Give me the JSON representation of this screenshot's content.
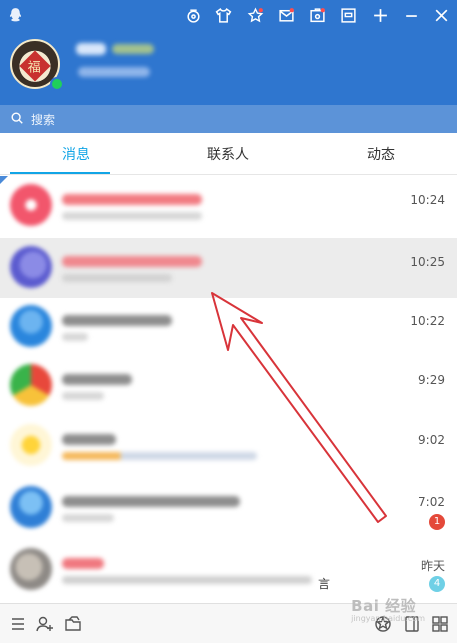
{
  "header": {
    "toolbar_icons": [
      "skin-icon",
      "shirt-icon",
      "star-icon",
      "mail-icon",
      "app-box-icon",
      "screen-icon",
      "add-icon",
      "minimize-icon",
      "close-icon"
    ],
    "avatar_char": "福",
    "online_color": "#1fd05b",
    "accent": "#2f76cf"
  },
  "search": {
    "placeholder": "搜索"
  },
  "tabs": [
    {
      "label": "消息",
      "active": true
    },
    {
      "label": "联系人",
      "active": false
    },
    {
      "label": "动态",
      "active": false
    }
  ],
  "conversations": [
    {
      "time": "10:24",
      "badge": ""
    },
    {
      "time": "10:25",
      "badge": "",
      "selected": true
    },
    {
      "time": "10:22",
      "badge": ""
    },
    {
      "time": "9:29",
      "badge": ""
    },
    {
      "time": "9:02",
      "badge": ""
    },
    {
      "time": "7:02",
      "badge": "1",
      "badge_color": "#e4493a"
    },
    {
      "time": "昨天",
      "badge": "4",
      "badge_color": "#6fd0e6",
      "tail": "言"
    }
  ],
  "bottombar": {
    "icons": [
      "menu-icon",
      "add-contact-icon",
      "folder-icon",
      "qzone-icon",
      "tablet-icon",
      "apps-icon"
    ]
  },
  "watermark": {
    "text": "Bai 经验",
    "sub": "jingyan.baidu.com"
  },
  "annotation": {
    "color": "#d8343a"
  }
}
